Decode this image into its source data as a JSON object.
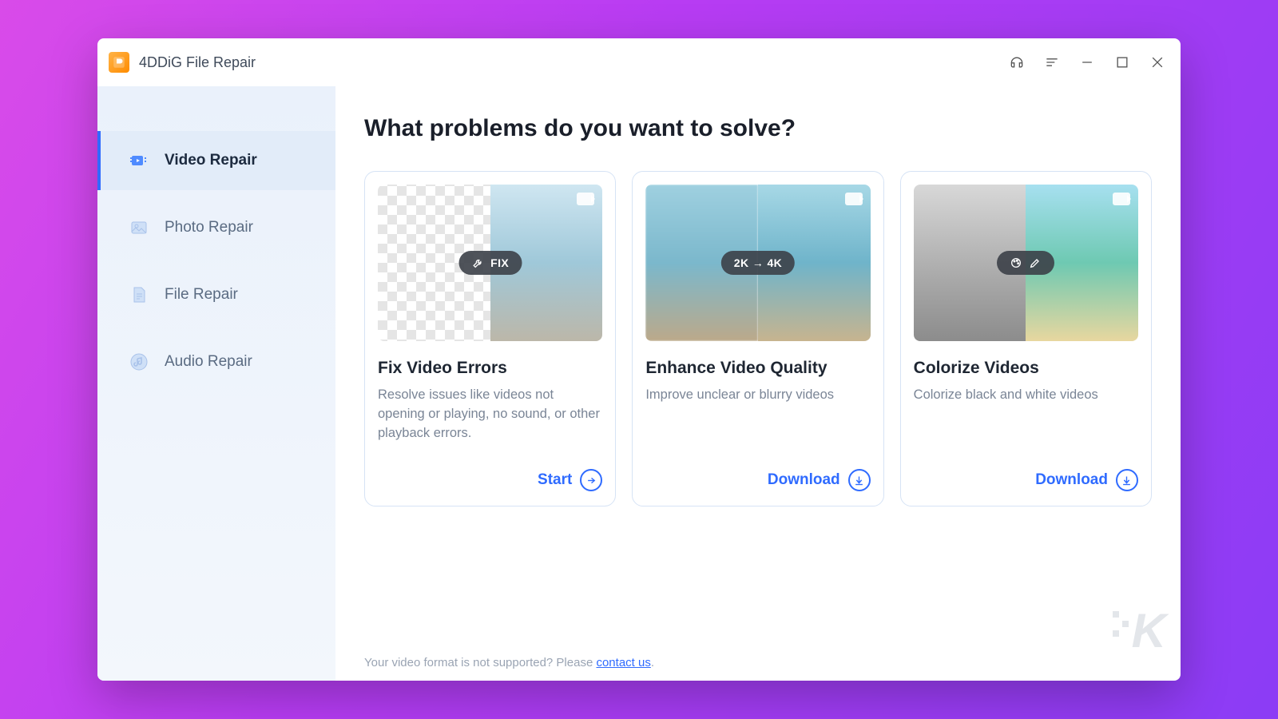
{
  "app": {
    "title": "4DDiG File Repair"
  },
  "sidebar": {
    "items": [
      {
        "label": "Video Repair",
        "icon": "video-icon",
        "active": true
      },
      {
        "label": "Photo Repair",
        "icon": "photo-icon",
        "active": false
      },
      {
        "label": "File Repair",
        "icon": "file-icon",
        "active": false
      },
      {
        "label": "Audio Repair",
        "icon": "audio-icon",
        "active": false
      }
    ]
  },
  "main": {
    "heading": "What problems do you want to solve?",
    "cards": [
      {
        "badge": "FIX",
        "title": "Fix Video Errors",
        "desc": "Resolve issues like videos not opening or playing, no sound, or other playback errors.",
        "action_label": "Start",
        "action_kind": "start"
      },
      {
        "badge": "2K → 4K",
        "title": "Enhance Video Quality",
        "desc": "Improve unclear or blurry videos",
        "action_label": "Download",
        "action_kind": "download"
      },
      {
        "badge": "",
        "title": "Colorize Videos",
        "desc": "Colorize black and white videos",
        "action_label": "Download",
        "action_kind": "download"
      }
    ],
    "footer_prefix": "Your video format is not supported? Please ",
    "footer_link": "contact us",
    "footer_suffix": "."
  },
  "watermark": "K"
}
